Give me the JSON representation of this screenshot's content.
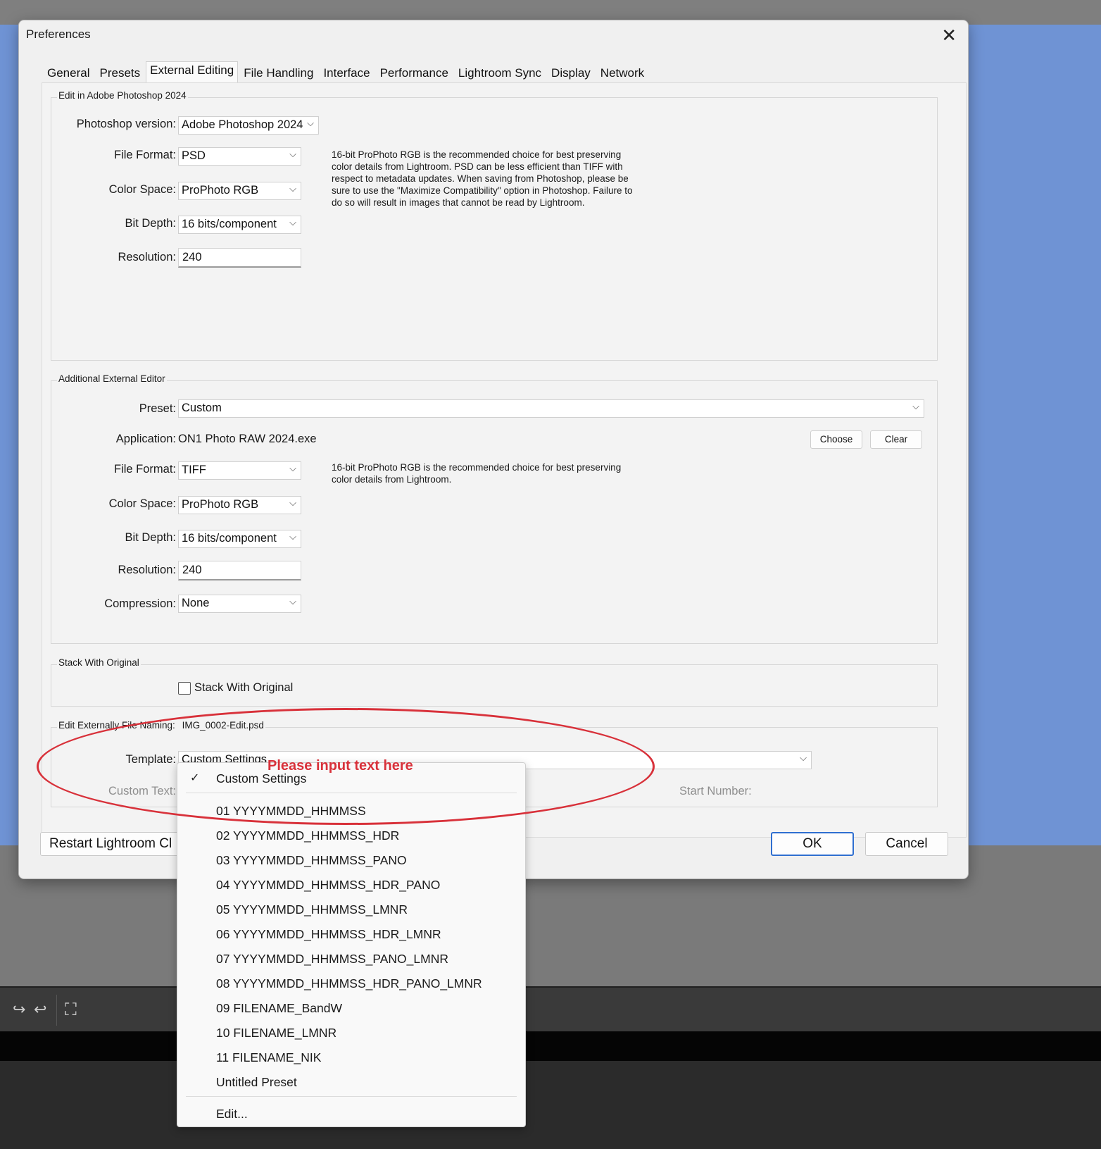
{
  "dialog": {
    "title": "Preferences",
    "tabs": [
      "General",
      "Presets",
      "External Editing",
      "File Handling",
      "Interface",
      "Performance",
      "Lightroom Sync",
      "Display",
      "Network"
    ],
    "active_tab": "External Editing"
  },
  "photoshop": {
    "group_title": "Edit in Adobe Photoshop 2024",
    "version_label": "Photoshop version:",
    "version_value": "Adobe Photoshop 2024",
    "format_label": "File Format:",
    "format_value": "PSD",
    "colorspace_label": "Color Space:",
    "colorspace_value": "ProPhoto RGB",
    "bitdepth_label": "Bit Depth:",
    "bitdepth_value": "16 bits/component",
    "resolution_label": "Resolution:",
    "resolution_value": "240",
    "note": "16-bit ProPhoto RGB is the recommended choice for best preserving color details from Lightroom. PSD can be less efficient than TIFF with respect to metadata updates. When saving from Photoshop, please be sure to use the \"Maximize Compatibility\" option in Photoshop. Failure to do so will result in images that cannot be read by Lightroom."
  },
  "additional": {
    "group_title": "Additional External Editor",
    "preset_label": "Preset:",
    "preset_value": "Custom",
    "application_label": "Application:",
    "application_value": "ON1 Photo RAW 2024.exe",
    "choose_label": "Choose",
    "clear_label": "Clear",
    "format_label": "File Format:",
    "format_value": "TIFF",
    "colorspace_label": "Color Space:",
    "colorspace_value": "ProPhoto RGB",
    "bitdepth_label": "Bit Depth:",
    "bitdepth_value": "16 bits/component",
    "resolution_label": "Resolution:",
    "resolution_value": "240",
    "compression_label": "Compression:",
    "compression_value": "None",
    "note": "16-bit ProPhoto RGB is the recommended choice for best preserving color details from Lightroom."
  },
  "stack": {
    "group_title": "Stack With Original",
    "checkbox_label": "Stack With Original",
    "checked": false
  },
  "naming": {
    "group_title": "Edit Externally File Naming:",
    "example": "IMG_0002-Edit.psd",
    "template_label": "Template:",
    "template_value": "Custom Settings",
    "custom_text_label": "Custom Text:",
    "start_number_label": "Start Number:"
  },
  "buttons": {
    "restart": "Restart Lightroom Cl",
    "ok": "OK",
    "cancel": "Cancel"
  },
  "dropdown": {
    "selected": "Custom Settings",
    "items": [
      "01 YYYYMMDD_HHMMSS",
      "02 YYYYMMDD_HHMMSS_HDR",
      "03 YYYYMMDD_HHMMSS_PANO",
      "04 YYYYMMDD_HHMMSS_HDR_PANO",
      "05 YYYYMMDD_HHMMSS_LMNR",
      "06 YYYYMMDD_HHMMSS_HDR_LMNR",
      "07 YYYYMMDD_HHMMSS_PANO_LMNR",
      "08 YYYYMMDD_HHMMSS_HDR_PANO_LMNR",
      "09 FILENAME_BandW",
      "10 FILENAME_LMNR",
      "11 FILENAME_NIK",
      "Untitled Preset"
    ],
    "edit": "Edit..."
  },
  "annotation": {
    "text": "Please input text here",
    "color": "#d8313a"
  },
  "colors": {
    "background_blue": "#6f93d4",
    "default_button_border": "#2f6fd0"
  }
}
